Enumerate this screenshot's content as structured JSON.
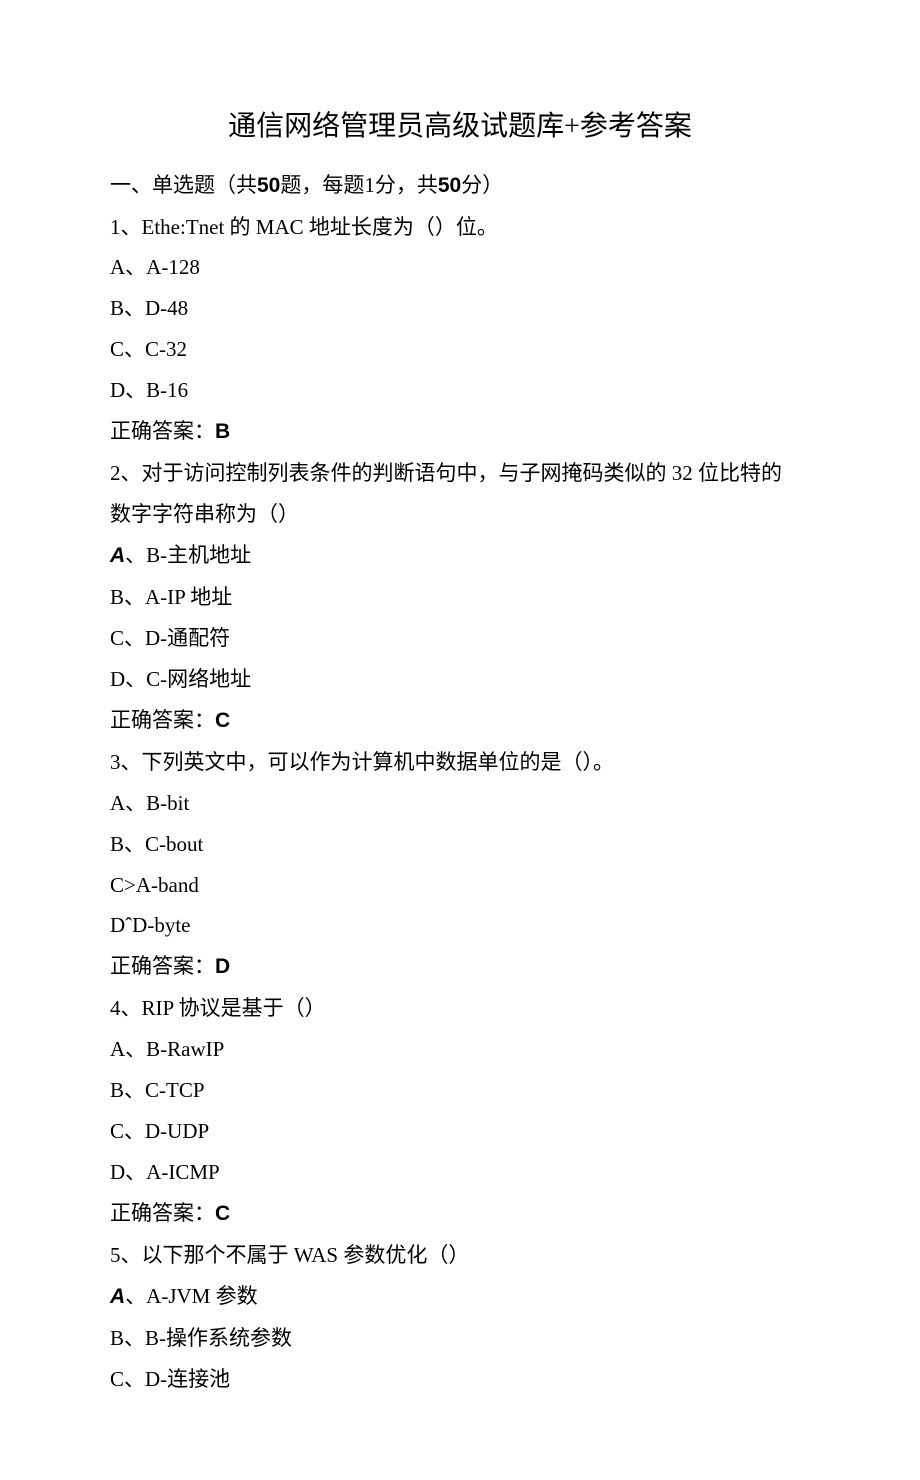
{
  "title": "通信网络管理员高级试题库+参考答案",
  "section": {
    "prefix": "一、单选题（共",
    "count1": "50",
    "mid1": "题，每题",
    "points": "1",
    "mid2": "分，共",
    "count2": "50",
    "suffix": "分）"
  },
  "q1": {
    "stem": "1、Ethe:Tnet 的 MAC 地址长度为（）位。",
    "a": "A、A-128",
    "b": "B、D-48",
    "c": "C、C-32",
    "d": "D、B-16",
    "ans_label": "正确答案：",
    "ans": "B"
  },
  "q2": {
    "stem1": "2、对于访问控制列表条件的判断语句中，与子网掩码类似的 32 位比特的",
    "stem2": "数字字符串称为（）",
    "a_letter": "A",
    "a_rest": "、B-主机地址",
    "b": "B、A-IP 地址",
    "c": "C、D-通配符",
    "d": "D、C-网络地址",
    "ans_label": "正确答案：",
    "ans": "C"
  },
  "q3": {
    "stem": "3、下列英文中，可以作为计算机中数据单位的是（）。",
    "a": "A、B-bit",
    "b": "B、C-bout",
    "c": "C>A-band",
    "d": "DˆD-byte",
    "ans_label": "正确答案：",
    "ans": "D"
  },
  "q4": {
    "stem": "4、RIP 协议是基于（）",
    "a": "A、B-RawIP",
    "b": "B、C-TCP",
    "c": "C、D-UDP",
    "d": "D、A-ICMP",
    "ans_label": "正确答案：",
    "ans": "C"
  },
  "q5": {
    "stem": "5、以下那个不属于 WAS 参数优化（）",
    "a_letter": "A",
    "a_rest": "、A-JVM 参数",
    "b": "B、B-操作系统参数",
    "c": "C、D-连接池"
  }
}
